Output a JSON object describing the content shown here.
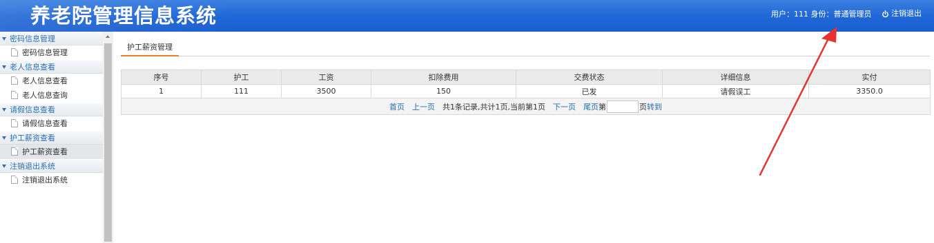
{
  "header": {
    "title": "养老院管理信息系统",
    "user_info": "用户：111 身份：普通管理员",
    "logout_label": "注销退出",
    "logout_icon": "power-icon",
    "bg_color": "#1f66d6"
  },
  "sidebar": {
    "groups": [
      {
        "title": "密码信息管理",
        "items": [
          {
            "label": "密码信息管理"
          }
        ]
      },
      {
        "title": "老人信息查看",
        "items": [
          {
            "label": "老人信息查看"
          },
          {
            "label": "老人信息查询"
          }
        ]
      },
      {
        "title": "请假信息查看",
        "items": [
          {
            "label": "请假信息查看"
          }
        ]
      },
      {
        "title": "护工薪资查看",
        "items": [
          {
            "label": "护工薪资查看",
            "active": true
          }
        ]
      },
      {
        "title": "注销退出系统",
        "items": [
          {
            "label": "注销退出系统"
          }
        ]
      }
    ]
  },
  "main": {
    "tab_label": "护工薪资管理",
    "tab_accent": "#e8802b",
    "table": {
      "columns": [
        "序号",
        "护工",
        "工资",
        "扣除费用",
        "交费状态",
        "详细信息",
        "实付"
      ],
      "rows": [
        [
          "1",
          "111",
          "3500",
          "150",
          "已发",
          "请假误工",
          "3350.0"
        ]
      ]
    },
    "pager": {
      "first": "首页",
      "prev": "上一页",
      "summary": "共1条记录,共计1页,当前第1页",
      "next": "下一页",
      "last": "尾页",
      "goto_prefix": "第",
      "goto_suffix": "页",
      "goto_button": "转到",
      "page_value": ""
    }
  },
  "annotation": {
    "arrow_color": "#e8322f"
  }
}
